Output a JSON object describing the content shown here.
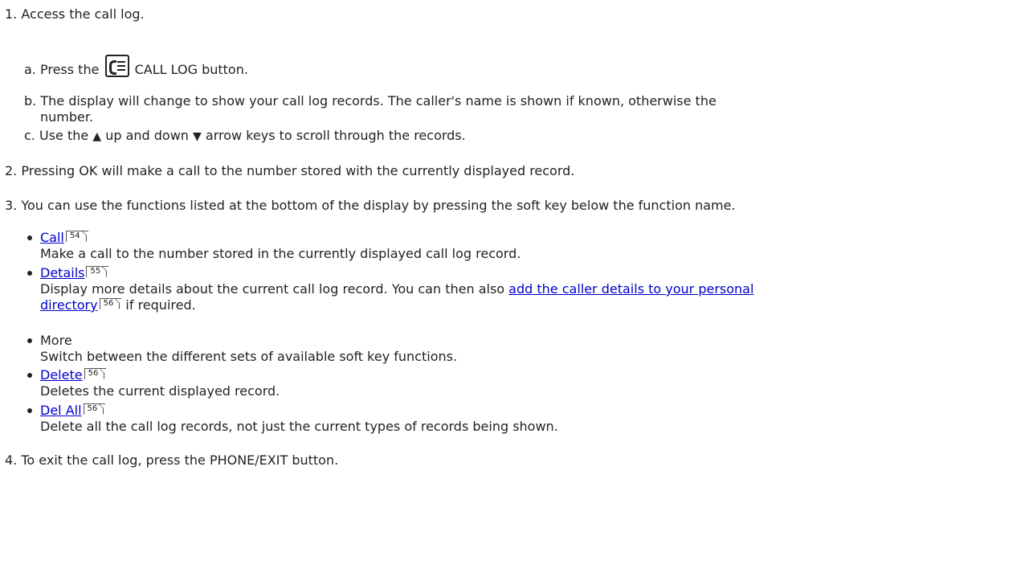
{
  "steps": {
    "s1": {
      "num": "1.",
      "text": "Access the call log."
    },
    "s1a": {
      "letter": "a.",
      "pre": "Press the",
      "icon": "call-log-icon",
      "post": "CALL LOG button."
    },
    "s1b": {
      "letter": "b.",
      "line1": "The display will change to show your call log records. The caller's name is shown if known, otherwise the",
      "line2": "number."
    },
    "s1c": {
      "letter": "c.",
      "pre": "Use the",
      "up_icon": "up-arrow-icon",
      "mid": "up and down",
      "down_icon": "down-arrow-icon",
      "post": "arrow keys to scroll through the records."
    },
    "s2": {
      "num": "2.",
      "text": "Pressing OK will make a call to the number stored with the currently displayed record."
    },
    "s3": {
      "num": "3.",
      "text": "You can use the functions listed at the bottom of the display by pressing the soft key below the function name."
    },
    "s4": {
      "num": "4.",
      "text": "To exit the call log, press the PHONE/EXIT button."
    }
  },
  "functions": {
    "call": {
      "link": "Call",
      "page": "54",
      "desc": "Make a call to the number stored in the currently displayed call log record."
    },
    "details": {
      "link": "Details",
      "page": "55",
      "desc_pre": "Display more details about the current call log record. You can then also",
      "inline_link_1": "add the caller details to your personal",
      "inline_link_2": "directory",
      "inline_page": "56",
      "desc_post": "if required."
    },
    "more": {
      "label": "More",
      "desc": "Switch between the different sets of available soft key functions."
    },
    "delete": {
      "link": "Delete",
      "page": "56",
      "desc": "Deletes the current displayed record."
    },
    "delall": {
      "link": "Del All",
      "page": "56",
      "desc": "Delete all the call log records, not just the current types of records being shown."
    }
  },
  "colors": {
    "link": "#0000cc",
    "text": "#222222"
  }
}
